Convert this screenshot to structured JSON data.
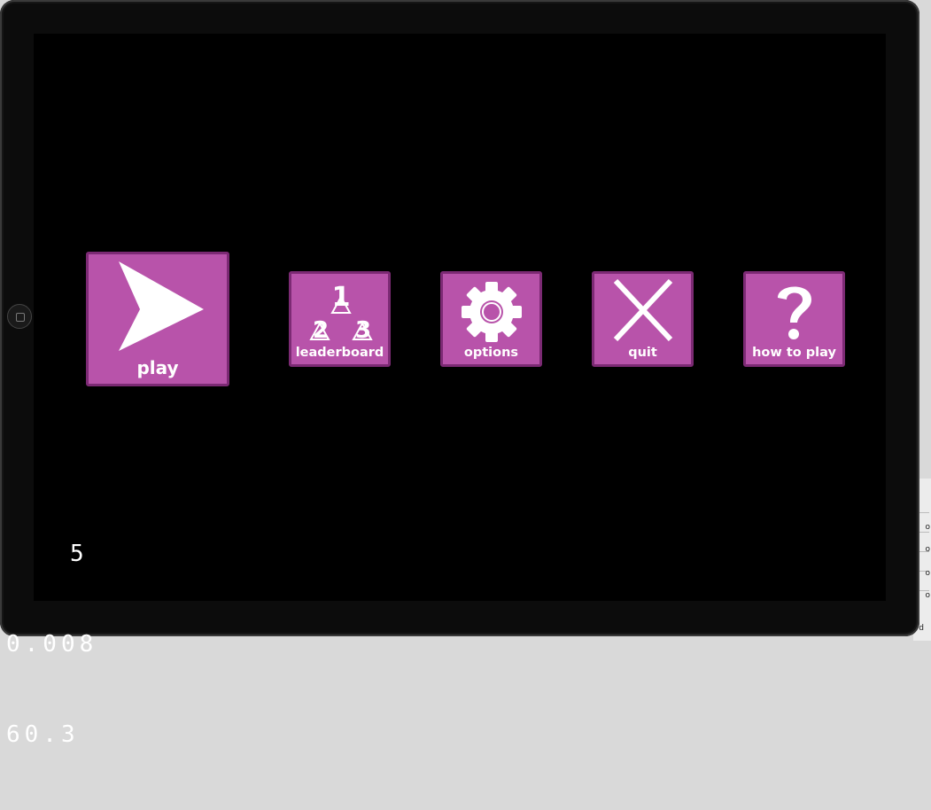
{
  "menu": {
    "play_label": "play",
    "leaderboard_label": "leaderboard",
    "options_label": "options",
    "quit_label": "quit",
    "how_to_play_label": "how to play"
  },
  "podium": {
    "first": "1",
    "second": "2",
    "third": "3"
  },
  "debug_stats": {
    "line1": "5",
    "line2": "0.008",
    "line3": "60.3"
  },
  "colors": {
    "button_fill": "#b853aa",
    "button_border": "#7c2a74",
    "screen_background": "#000000",
    "icon_color": "#ffffff"
  },
  "icons": {
    "play": "play-arrow-icon",
    "leaderboard": "podium-icon",
    "options": "gear-icon",
    "quit": "close-icon",
    "how_to_play": "question-mark-icon"
  },
  "background_fragments": [
    "o",
    "o",
    "o",
    "o",
    "d"
  ]
}
